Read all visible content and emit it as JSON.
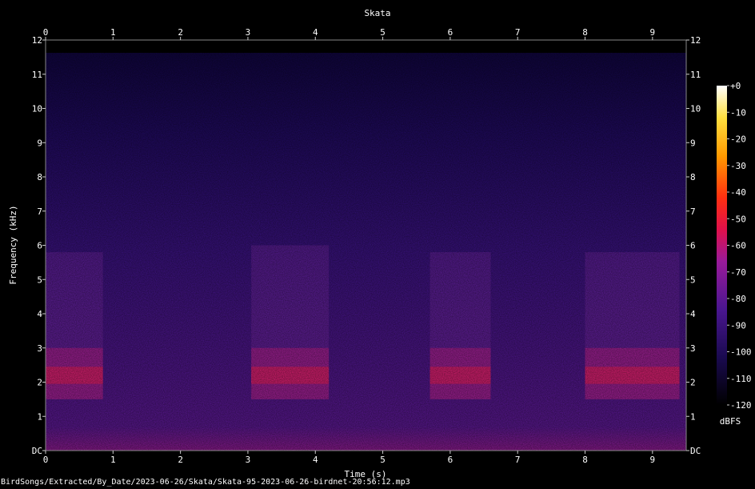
{
  "chart_data": {
    "type": "heatmap",
    "title": "Skata",
    "xlabel": "Time (s)",
    "ylabel": "Frequency (kHz)",
    "xlim": [
      0,
      9.5
    ],
    "ylim": [
      0,
      12
    ],
    "x_ticks": [
      "0",
      "1",
      "2",
      "3",
      "4",
      "5",
      "6",
      "7",
      "8",
      "9"
    ],
    "y_ticks": [
      "DC",
      "1",
      "2",
      "3",
      "4",
      "5",
      "6",
      "7",
      "8",
      "9",
      "10",
      "11",
      "12"
    ],
    "colorbar": {
      "label": "dBFS",
      "range": [
        -120,
        0
      ],
      "ticks": [
        "+0",
        "-10",
        "-20",
        "-30",
        "-40",
        "-50",
        "-60",
        "-70",
        "-80",
        "-90",
        "-100",
        "-110",
        "-120"
      ]
    },
    "calls": [
      {
        "t_start": 0.0,
        "t_end": 0.85,
        "f_low_khz": 1.5,
        "f_high_khz": 5.8,
        "peak_khz": 2.2
      },
      {
        "t_start": 3.05,
        "t_end": 4.2,
        "f_low_khz": 1.5,
        "f_high_khz": 6.0,
        "peak_khz": 2.2
      },
      {
        "t_start": 5.7,
        "t_end": 6.6,
        "f_low_khz": 1.5,
        "f_high_khz": 5.8,
        "peak_khz": 2.2
      },
      {
        "t_start": 8.0,
        "t_end": 9.4,
        "f_low_khz": 1.5,
        "f_high_khz": 5.8,
        "peak_khz": 2.2
      }
    ]
  },
  "footer": {
    "path": "BirdSongs/Extracted/By_Date/2023-06-26/Skata/Skata-95-2023-06-26-birdnet-20:56:12.mp3"
  }
}
